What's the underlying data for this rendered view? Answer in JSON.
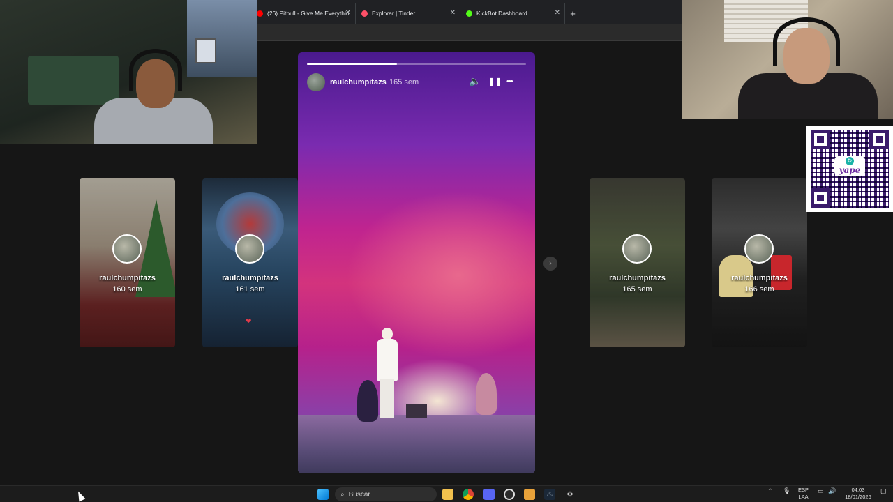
{
  "browser": {
    "tabs": [
      {
        "label": "(26) Pitbull - Give Me Everythin",
        "favicon_color": "#ff0000"
      },
      {
        "label": "Explorar | Tinder",
        "favicon_color": "#fd5068"
      },
      {
        "label": "KickBot Dashboard",
        "favicon_color": "#53fc18"
      }
    ],
    "close_glyph": "✕",
    "new_tab_glyph": "+"
  },
  "story_viewer": {
    "main": {
      "username": "raulchumpitazs",
      "time_ago": "165 sem",
      "progress": 0.41,
      "controls": {
        "mute_glyph": "🔈",
        "pause_glyph": "❚❚",
        "more_glyph": "•••"
      }
    },
    "cards": [
      {
        "username": "raulchumpitazs",
        "time_ago": "160 sem"
      },
      {
        "username": "raulchumpitazs",
        "time_ago": "161 sem"
      },
      {
        "username": "raulchumpitazs",
        "time_ago": "165 sem"
      },
      {
        "username": "raulchumpitazs",
        "time_ago": "166 sem"
      }
    ],
    "next_glyph": "›"
  },
  "qr": {
    "brand": "yape"
  },
  "taskbar": {
    "search_placeholder": "Buscar",
    "lang_top": "ESP",
    "lang_bottom": "LAA",
    "time": "04:03",
    "date": "18/01/2026",
    "icons": [
      "windows-start-icon",
      "file-explorer-icon",
      "chrome-icon",
      "discord-icon",
      "obs-icon",
      "app-icon",
      "steam-icon",
      "settings-icon"
    ]
  },
  "colors": {
    "accent_story": "#c0248f",
    "taskbar_bg": "#1c1c1c"
  }
}
